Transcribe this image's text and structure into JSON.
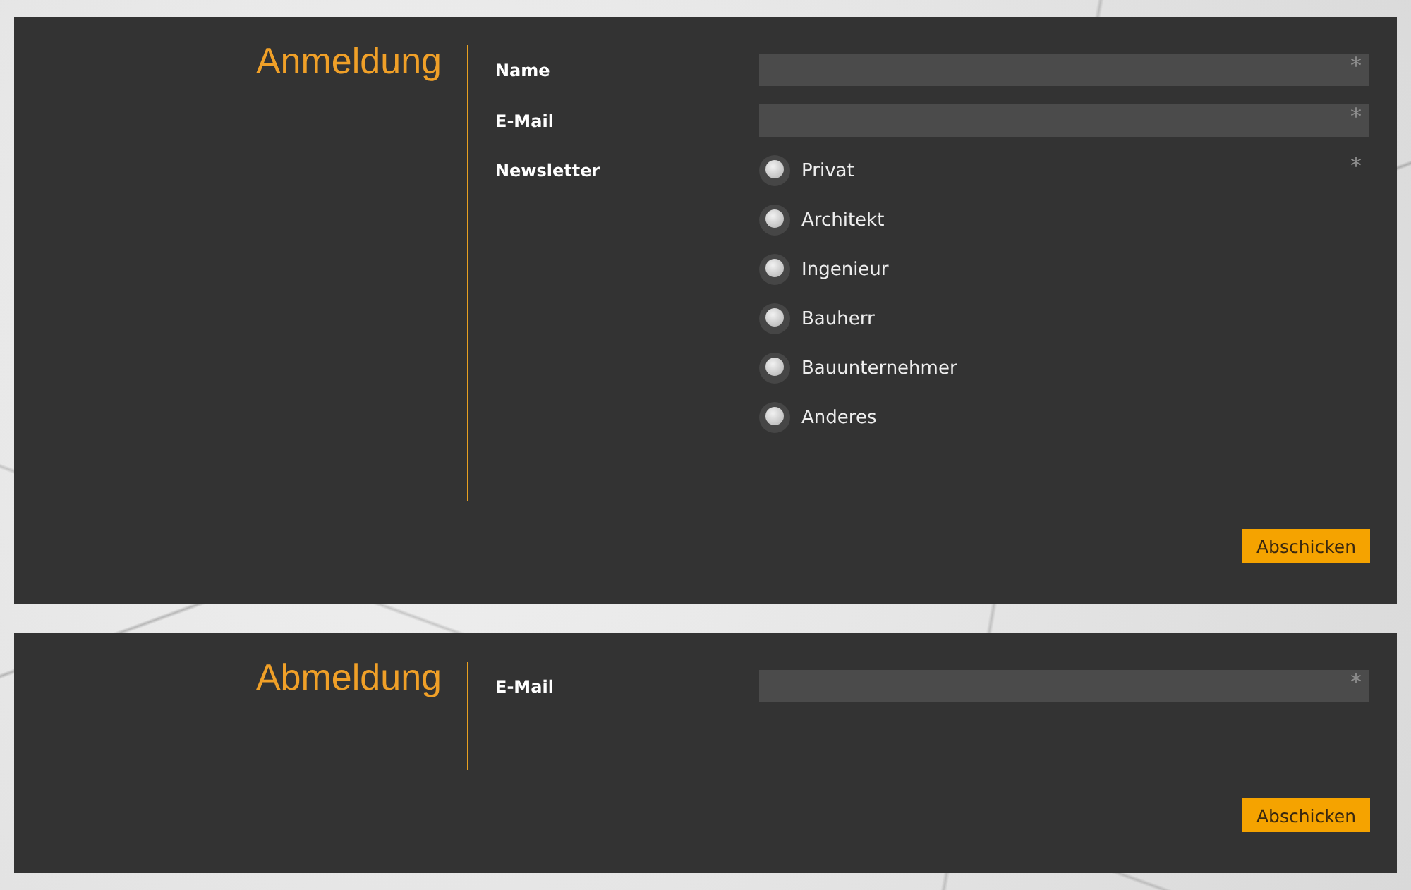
{
  "forms": [
    {
      "title": "Anmeldung",
      "fields": [
        {
          "kind": "text",
          "label": "Name",
          "required_mark": "*"
        },
        {
          "kind": "text",
          "label": "E-Mail",
          "required_mark": "*"
        },
        {
          "kind": "radio",
          "label": "Newsletter",
          "required_mark": "*",
          "options": [
            {
              "label": "Privat",
              "selected": false
            },
            {
              "label": "Architekt",
              "selected": false
            },
            {
              "label": "Ingenieur",
              "selected": false
            },
            {
              "label": "Bauherr",
              "selected": false
            },
            {
              "label": "Bauunternehmer",
              "selected": false
            },
            {
              "label": "Anderes",
              "selected": false
            }
          ]
        }
      ],
      "submit": "Abschicken"
    },
    {
      "title": "Abmeldung",
      "fields": [
        {
          "kind": "text",
          "label": "E-Mail",
          "required_mark": "*"
        }
      ],
      "submit": "Abschicken"
    }
  ]
}
